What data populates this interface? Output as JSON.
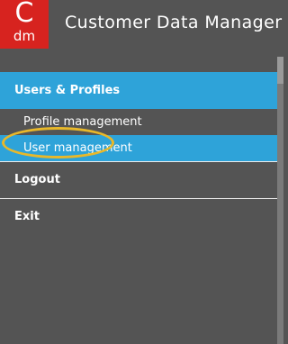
{
  "header": {
    "logo_top": "C",
    "logo_bottom": "dm",
    "title": "Customer Data Manager"
  },
  "nav": {
    "section_label": "Users & Profiles",
    "sub_items": [
      {
        "label": "Profile management",
        "active": false
      },
      {
        "label": "User management",
        "active": true
      }
    ],
    "logout_label": "Logout",
    "exit_label": "Exit"
  },
  "colors": {
    "background": "#545454",
    "accent": "#2ea3d9",
    "logo_red": "#d7231f",
    "highlight_ring": "#e8b82a"
  }
}
